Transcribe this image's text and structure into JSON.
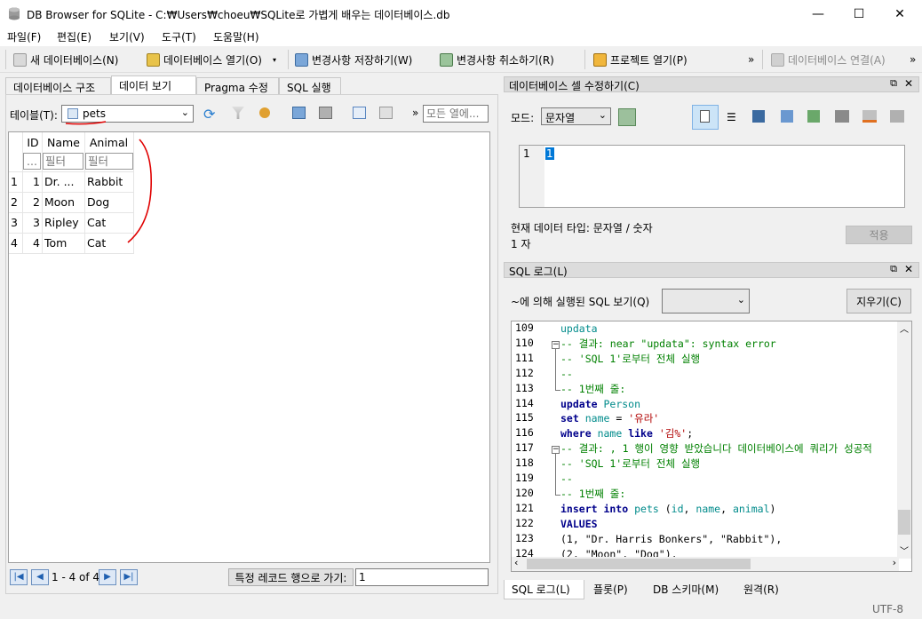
{
  "window": {
    "title": "DB Browser for SQLite - C:₩Users₩choeu₩SQLite로 가볍게 배우는 데이터베이스.db",
    "min": "—",
    "max": "☐",
    "close": "✕"
  },
  "menu": [
    "파일(F)",
    "편집(E)",
    "보기(V)",
    "도구(T)",
    "도움말(H)"
  ],
  "toolbar": {
    "new_db": "새 데이터베이스(N)",
    "open_db": "데이터베이스 열기(O)",
    "write": "변경사항 저장하기(W)",
    "revert": "변경사항 취소하기(R)",
    "open_project": "프로젝트 열기(P)",
    "attach": "데이터베이스 연결(A)",
    "more": "»"
  },
  "tabs": [
    "데이터베이스 구조",
    "데이터 보기",
    "Pragma 수정",
    "SQL 실행"
  ],
  "browse": {
    "table_label": "테이블(T):",
    "table_value": "pets",
    "filter_placeholder": "모든 열에...",
    "more": "»"
  },
  "grid": {
    "columns": [
      "ID",
      "Name",
      "Animal"
    ],
    "filter_cells": [
      "...",
      "필터",
      "필터"
    ],
    "rows": [
      {
        "n": "1",
        "id": "1",
        "name": "Dr. ...",
        "animal": "Rabbit"
      },
      {
        "n": "2",
        "id": "2",
        "name": "Moon",
        "animal": "Dog"
      },
      {
        "n": "3",
        "id": "3",
        "name": "Ripley",
        "animal": "Cat"
      },
      {
        "n": "4",
        "id": "4",
        "name": "Tom",
        "animal": "Cat"
      }
    ]
  },
  "nav": {
    "range": "1 - 4 of 4",
    "goto_label": "특정 레코드 행으로 가기:",
    "goto_value": "1"
  },
  "editcell": {
    "title": "데이터베이스 셀 수정하기(C)",
    "mode_label": "모드:",
    "mode_value": "문자열",
    "line_no": "1",
    "cell_value": "1",
    "type_info": "현재 데이터 타입: 문자열 / 숫자",
    "size_info": "1 자",
    "apply": "적용"
  },
  "sqllog": {
    "title": "SQL 로그(L)",
    "filter_label": "~에 의해 실행된 SQL 보기(Q)",
    "clear": "지우기(C)",
    "line_numbers": [
      "109",
      "110",
      "111",
      "112",
      "113",
      "114",
      "115",
      "116",
      "117",
      "118",
      "119",
      "120",
      "121",
      "122",
      "123",
      "124"
    ]
  },
  "bottom_tabs": [
    "SQL 로그(L)",
    "플롯(P)",
    "DB 스키마(M)",
    "원격(R)"
  ],
  "status": {
    "encoding": "UTF-8"
  }
}
